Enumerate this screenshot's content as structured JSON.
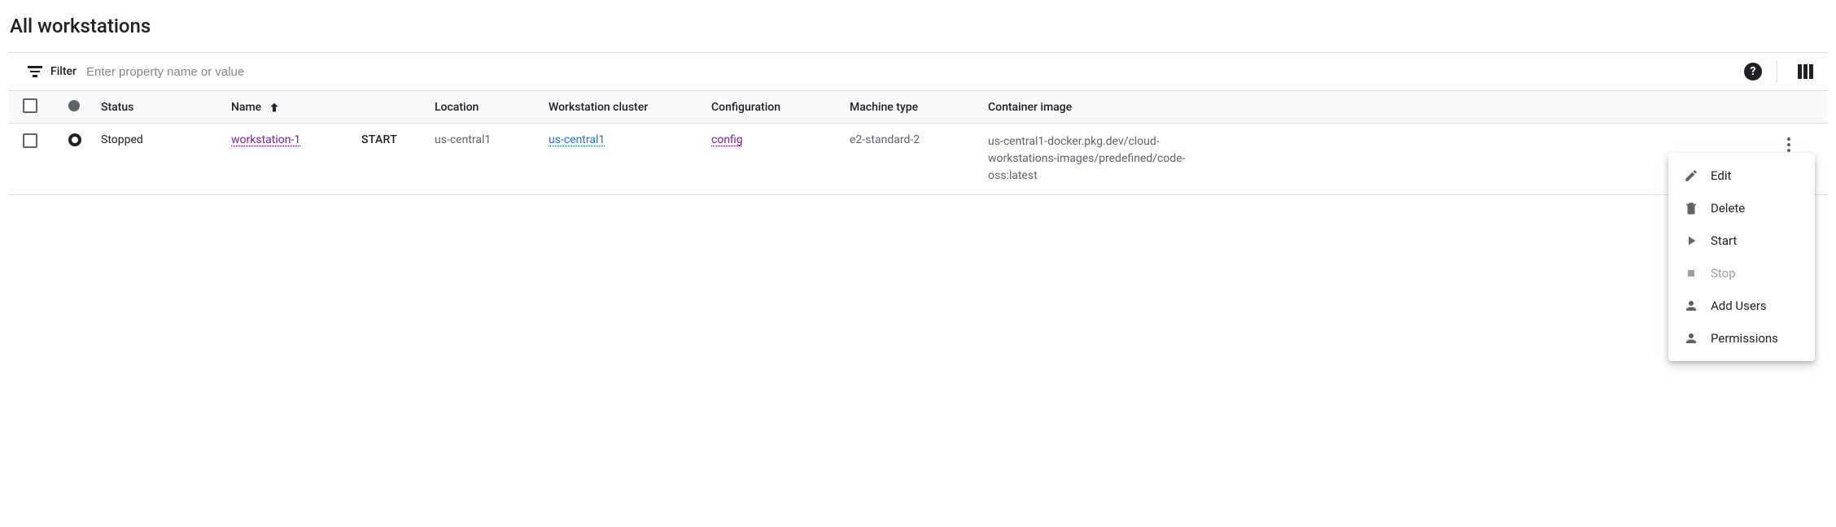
{
  "page": {
    "title": "All workstations"
  },
  "filter": {
    "label": "Filter",
    "placeholder": "Enter property name or value"
  },
  "columns": {
    "status": "Status",
    "name": "Name",
    "location": "Location",
    "cluster": "Workstation cluster",
    "configuration": "Configuration",
    "machine_type": "Machine type",
    "container_image": "Container image"
  },
  "rows": [
    {
      "status": "Stopped",
      "name": "workstation-1",
      "action": "START",
      "location": "us-central1",
      "cluster": "us-central1",
      "configuration": "config",
      "machine_type": "e2-standard-2",
      "container_image": "us-central1-docker.pkg.dev/cloud-workstations-images/predefined/code-oss:latest"
    }
  ],
  "menu": {
    "edit": "Edit",
    "delete": "Delete",
    "start": "Start",
    "stop": "Stop",
    "add_users": "Add Users",
    "permissions": "Permissions"
  }
}
